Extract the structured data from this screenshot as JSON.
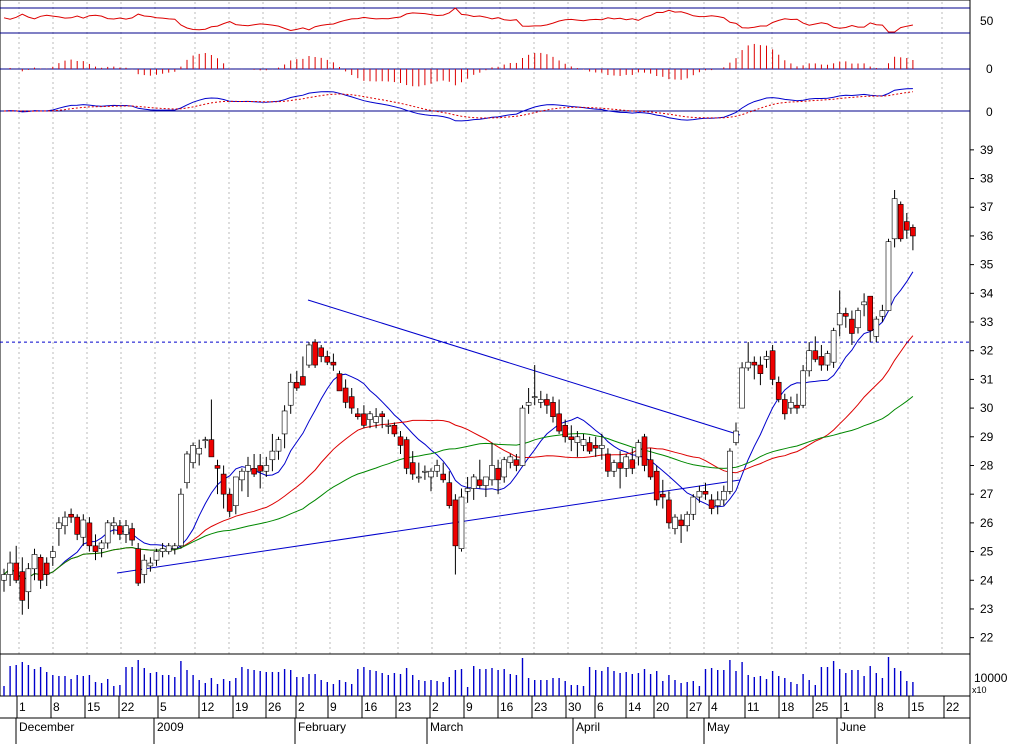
{
  "chart_data": {
    "type": "candlestick",
    "price_axis": {
      "ticks": [
        "22",
        "23",
        "24",
        "25",
        "26",
        "27",
        "28",
        "29",
        "30",
        "31",
        "32",
        "33",
        "34",
        "35",
        "36",
        "37",
        "38",
        "39"
      ],
      "ylim": [
        21.5,
        39.5
      ],
      "resistance_level": 32.3
    },
    "rsi_panel": {
      "tick": "50",
      "upper_line": 70,
      "lower_line": 30
    },
    "macd_hist_panel": {
      "tick": "0"
    },
    "macd_panel": {
      "tick": "0"
    },
    "volume_panel": {
      "tick": "10000",
      "multiplier": "x10"
    },
    "date_axis": {
      "day_ticks": [
        "1",
        "8",
        "15",
        "22",
        "5",
        "12",
        "19",
        "26",
        "2",
        "9",
        "16",
        "23",
        "2",
        "9",
        "16",
        "23",
        "30",
        "6",
        "14",
        "20",
        "27",
        "4",
        "11",
        "18",
        "25",
        "1",
        "8",
        "15",
        "22"
      ],
      "month_labels": [
        "December",
        "2009",
        "February",
        "March",
        "April",
        "May",
        "June"
      ]
    },
    "candles": [
      [
        24.0,
        24.4,
        23.6,
        24.2
      ],
      [
        24.2,
        25.0,
        23.8,
        24.6
      ],
      [
        24.6,
        25.2,
        23.9,
        24.0
      ],
      [
        24.3,
        24.8,
        22.8,
        23.3
      ],
      [
        23.6,
        24.6,
        23.0,
        24.4
      ],
      [
        24.4,
        25.1,
        24.0,
        24.9
      ],
      [
        24.8,
        24.9,
        23.7,
        24.0
      ],
      [
        24.6,
        24.8,
        23.8,
        24.2
      ],
      [
        24.8,
        25.2,
        24.5,
        25.0
      ],
      [
        25.8,
        26.2,
        25.2,
        26.0
      ],
      [
        25.9,
        26.4,
        25.6,
        26.2
      ],
      [
        26.3,
        26.5,
        26.0,
        26.2
      ],
      [
        26.2,
        26.3,
        25.4,
        25.6
      ],
      [
        25.5,
        26.3,
        25.2,
        26.1
      ],
      [
        26.0,
        26.2,
        25.0,
        25.2
      ],
      [
        25.2,
        25.6,
        24.7,
        25.0
      ],
      [
        25.1,
        25.4,
        24.8,
        25.3
      ],
      [
        25.3,
        26.1,
        25.1,
        26.0
      ],
      [
        25.9,
        26.2,
        25.6,
        26.0
      ],
      [
        25.9,
        26.1,
        25.4,
        25.6
      ],
      [
        25.6,
        26.1,
        25.3,
        25.9
      ],
      [
        25.8,
        26.0,
        25.2,
        25.4
      ],
      [
        25.1,
        25.3,
        23.8,
        23.9
      ],
      [
        24.2,
        24.9,
        23.9,
        24.7
      ],
      [
        24.5,
        24.8,
        24.3,
        24.6
      ],
      [
        24.7,
        25.1,
        24.5,
        25.0
      ],
      [
        25.0,
        25.3,
        24.8,
        25.1
      ],
      [
        25.0,
        25.3,
        24.9,
        25.2
      ],
      [
        25.1,
        25.3,
        24.9,
        25.2
      ],
      [
        25.2,
        27.2,
        25.1,
        27.0
      ],
      [
        27.4,
        28.5,
        27.2,
        28.4
      ],
      [
        28.1,
        28.8,
        27.9,
        28.7
      ],
      [
        28.4,
        28.9,
        28.0,
        28.6
      ],
      [
        28.9,
        29.0,
        28.6,
        28.9
      ],
      [
        28.9,
        30.3,
        28.5,
        28.3
      ],
      [
        28.0,
        28.2,
        27.0,
        27.9
      ],
      [
        27.7,
        28.0,
        26.5,
        27.0
      ],
      [
        27.0,
        27.2,
        26.2,
        26.4
      ],
      [
        26.6,
        27.6,
        26.3,
        27.6
      ],
      [
        27.5,
        27.9,
        27.1,
        27.8
      ],
      [
        27.8,
        28.3,
        26.9,
        28.0
      ],
      [
        27.9,
        28.4,
        27.6,
        27.7
      ],
      [
        28.0,
        28.4,
        27.2,
        27.8
      ],
      [
        27.8,
        28.3,
        27.6,
        28.0
      ],
      [
        28.2,
        29.1,
        27.8,
        28.5
      ],
      [
        28.5,
        29.0,
        28.2,
        28.9
      ],
      [
        29.1,
        30.1,
        28.6,
        29.9
      ],
      [
        30.1,
        31.2,
        29.8,
        30.9
      ],
      [
        30.9,
        31.3,
        30.6,
        30.7
      ],
      [
        31.1,
        31.8,
        30.9,
        30.8
      ],
      [
        31.5,
        32.3,
        31.4,
        32.2
      ],
      [
        32.3,
        32.4,
        31.4,
        31.5
      ],
      [
        32.1,
        32.2,
        31.6,
        31.8
      ],
      [
        31.8,
        32.0,
        31.5,
        31.6
      ],
      [
        31.6,
        31.9,
        31.3,
        31.5
      ],
      [
        31.2,
        31.3,
        30.6,
        30.6
      ],
      [
        30.7,
        31.0,
        30.0,
        30.2
      ],
      [
        30.4,
        30.7,
        29.8,
        30.0
      ],
      [
        29.8,
        30.0,
        29.6,
        29.7
      ],
      [
        29.8,
        30.1,
        29.3,
        29.4
      ],
      [
        29.6,
        29.9,
        29.3,
        29.8
      ],
      [
        29.5,
        30.0,
        29.3,
        29.7
      ],
      [
        29.8,
        29.9,
        29.3,
        29.7
      ],
      [
        29.4,
        29.6,
        29.1,
        29.4
      ],
      [
        29.4,
        29.5,
        29.0,
        29.1
      ],
      [
        29.0,
        29.2,
        28.4,
        28.7
      ],
      [
        28.9,
        29.0,
        27.7,
        27.9
      ],
      [
        28.1,
        28.5,
        27.5,
        27.7
      ],
      [
        27.6,
        28.1,
        27.4,
        27.6
      ],
      [
        27.8,
        28.0,
        27.5,
        27.8
      ],
      [
        27.6,
        27.9,
        27.1,
        27.8
      ],
      [
        27.8,
        28.2,
        27.6,
        28.0
      ],
      [
        27.7,
        28.1,
        27.4,
        27.5
      ],
      [
        27.4,
        27.8,
        26.5,
        26.6
      ],
      [
        26.8,
        27.0,
        24.2,
        25.2
      ],
      [
        25.1,
        27.2,
        25.0,
        26.9
      ],
      [
        27.1,
        27.6,
        26.7,
        27.2
      ],
      [
        27.2,
        27.7,
        26.8,
        27.6
      ],
      [
        27.5,
        28.2,
        27.2,
        27.3
      ],
      [
        27.3,
        27.6,
        26.9,
        27.6
      ],
      [
        27.5,
        28.8,
        27.3,
        28.0
      ],
      [
        27.9,
        28.2,
        27.0,
        27.5
      ],
      [
        27.6,
        28.3,
        27.4,
        28.2
      ],
      [
        28.1,
        28.4,
        27.9,
        28.3
      ],
      [
        28.2,
        28.4,
        27.8,
        28.0
      ],
      [
        28.0,
        30.1,
        28.0,
        30.0
      ],
      [
        30.1,
        30.7,
        29.8,
        30.2
      ],
      [
        30.4,
        31.5,
        30.1,
        30.4
      ],
      [
        30.2,
        30.6,
        30.0,
        30.3
      ],
      [
        30.3,
        30.5,
        29.8,
        30.1
      ],
      [
        30.2,
        30.4,
        29.5,
        29.7
      ],
      [
        29.8,
        30.3,
        29.1,
        29.2
      ],
      [
        29.4,
        29.6,
        28.8,
        29.0
      ],
      [
        29.0,
        29.4,
        28.5,
        28.9
      ],
      [
        28.8,
        29.2,
        28.3,
        29.0
      ],
      [
        28.7,
        29.1,
        28.5,
        28.9
      ],
      [
        28.8,
        29.0,
        28.4,
        28.5
      ],
      [
        28.7,
        29.0,
        28.3,
        28.6
      ],
      [
        28.6,
        29.1,
        28.2,
        28.7
      ],
      [
        28.4,
        28.6,
        27.6,
        27.8
      ],
      [
        27.8,
        28.2,
        27.6,
        28.1
      ],
      [
        28.1,
        28.5,
        27.2,
        27.9
      ],
      [
        27.9,
        28.4,
        27.6,
        28.3
      ],
      [
        28.2,
        28.6,
        27.7,
        27.9
      ],
      [
        28.3,
        28.9,
        28.0,
        28.8
      ],
      [
        29.0,
        29.1,
        27.8,
        28.0
      ],
      [
        28.2,
        28.6,
        27.5,
        27.6
      ],
      [
        27.8,
        28.0,
        26.6,
        26.8
      ],
      [
        27.0,
        27.5,
        26.5,
        26.9
      ],
      [
        26.8,
        27.1,
        25.8,
        26.0
      ],
      [
        25.8,
        26.3,
        25.6,
        26.2
      ],
      [
        26.1,
        26.3,
        25.3,
        25.9
      ],
      [
        25.9,
        26.4,
        25.7,
        26.3
      ],
      [
        26.3,
        27.0,
        26.1,
        26.9
      ],
      [
        26.9,
        27.3,
        26.7,
        27.1
      ],
      [
        27.1,
        27.4,
        26.8,
        27.0
      ],
      [
        26.8,
        27.0,
        26.3,
        26.5
      ],
      [
        26.6,
        27.1,
        26.3,
        26.8
      ],
      [
        26.8,
        27.3,
        26.6,
        27.1
      ],
      [
        27.1,
        28.6,
        27.0,
        28.5
      ],
      [
        28.8,
        29.5,
        28.7,
        29.2
      ],
      [
        30.0,
        31.6,
        30.0,
        31.4
      ],
      [
        31.4,
        32.3,
        31.3,
        31.6
      ],
      [
        31.6,
        31.8,
        31.0,
        31.5
      ],
      [
        31.5,
        31.8,
        30.8,
        31.2
      ],
      [
        31.7,
        32.0,
        31.4,
        31.8
      ],
      [
        32.0,
        32.2,
        30.8,
        31.0
      ],
      [
        30.9,
        31.1,
        30.2,
        30.3
      ],
      [
        30.3,
        30.5,
        29.6,
        29.8
      ],
      [
        30.0,
        30.4,
        29.8,
        30.2
      ],
      [
        30.1,
        30.5,
        29.8,
        30.0
      ],
      [
        30.1,
        31.5,
        30.0,
        31.3
      ],
      [
        31.3,
        32.3,
        31.1,
        32.0
      ],
      [
        32.0,
        32.5,
        31.6,
        31.7
      ],
      [
        31.8,
        32.2,
        31.3,
        31.5
      ],
      [
        31.5,
        32.0,
        31.3,
        31.9
      ],
      [
        31.6,
        32.8,
        31.4,
        32.7
      ],
      [
        32.9,
        34.1,
        32.5,
        33.3
      ],
      [
        33.3,
        33.5,
        32.8,
        33.2
      ],
      [
        33.1,
        33.4,
        32.2,
        32.6
      ],
      [
        32.8,
        33.5,
        32.6,
        33.4
      ],
      [
        33.6,
        34.0,
        33.2,
        33.7
      ],
      [
        33.9,
        33.9,
        32.3,
        32.7
      ],
      [
        32.5,
        33.2,
        32.3,
        33.1
      ],
      [
        33.2,
        33.6,
        33.0,
        33.4
      ],
      [
        33.4,
        35.9,
        33.4,
        35.8
      ],
      [
        35.9,
        37.6,
        35.6,
        37.3
      ],
      [
        37.1,
        37.2,
        35.8,
        35.9
      ],
      [
        36.5,
        36.8,
        35.9,
        36.2
      ],
      [
        36.3,
        36.4,
        35.5,
        36.0
      ]
    ]
  }
}
